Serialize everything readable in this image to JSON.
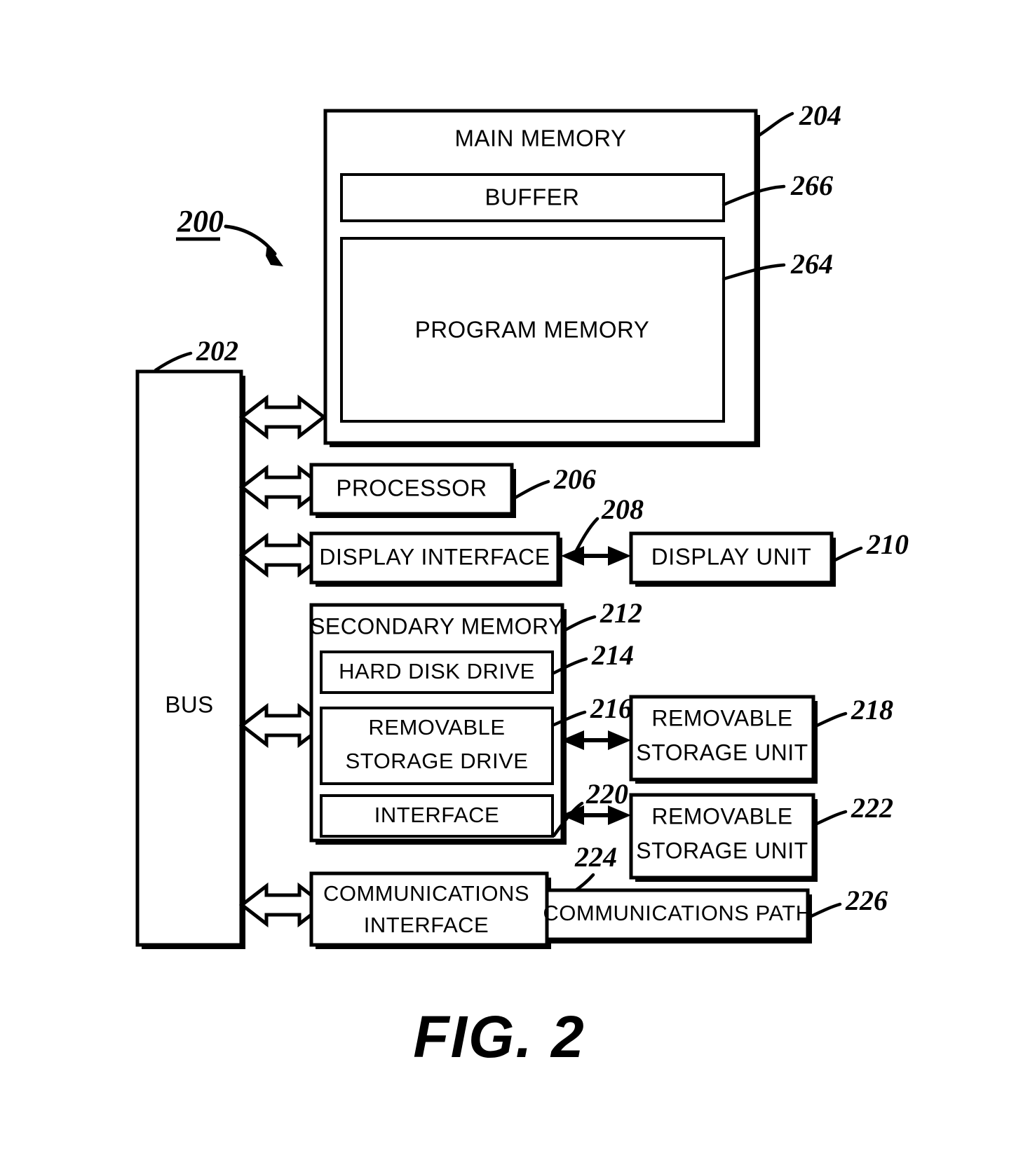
{
  "figure": {
    "caption": "FIG. 2",
    "system_ref": "200"
  },
  "blocks": {
    "main_memory": {
      "label": "MAIN MEMORY",
      "ref": "204"
    },
    "buffer": {
      "label": "BUFFER",
      "ref": "266"
    },
    "program_memory": {
      "label": "PROGRAM MEMORY",
      "ref": "264"
    },
    "bus": {
      "label": "BUS",
      "ref": "202"
    },
    "processor": {
      "label": "PROCESSOR",
      "ref": "206"
    },
    "display_interface": {
      "label": "DISPLAY INTERFACE",
      "ref": "208"
    },
    "display_unit": {
      "label": "DISPLAY UNIT",
      "ref": "210"
    },
    "secondary_memory": {
      "label": "SECONDARY MEMORY",
      "ref": "212"
    },
    "hard_disk_drive": {
      "label": "HARD DISK DRIVE",
      "ref": "214"
    },
    "removable_storage_drive": {
      "label_line1": "REMOVABLE",
      "label_line2": "STORAGE DRIVE",
      "ref": "216"
    },
    "removable_storage_unit_1": {
      "label_line1": "REMOVABLE",
      "label_line2": "STORAGE UNIT",
      "ref": "218"
    },
    "interface": {
      "label": "INTERFACE",
      "ref": "220"
    },
    "removable_storage_unit_2": {
      "label_line1": "REMOVABLE",
      "label_line2": "STORAGE UNIT",
      "ref": "222"
    },
    "communications_interface": {
      "label_line1": "COMMUNICATIONS",
      "label_line2": "INTERFACE",
      "ref": "224"
    },
    "communications_path": {
      "label": "COMMUNICATIONS PATH",
      "ref": "226"
    }
  },
  "colors": {
    "ink": "#000000",
    "paper": "#ffffff"
  }
}
